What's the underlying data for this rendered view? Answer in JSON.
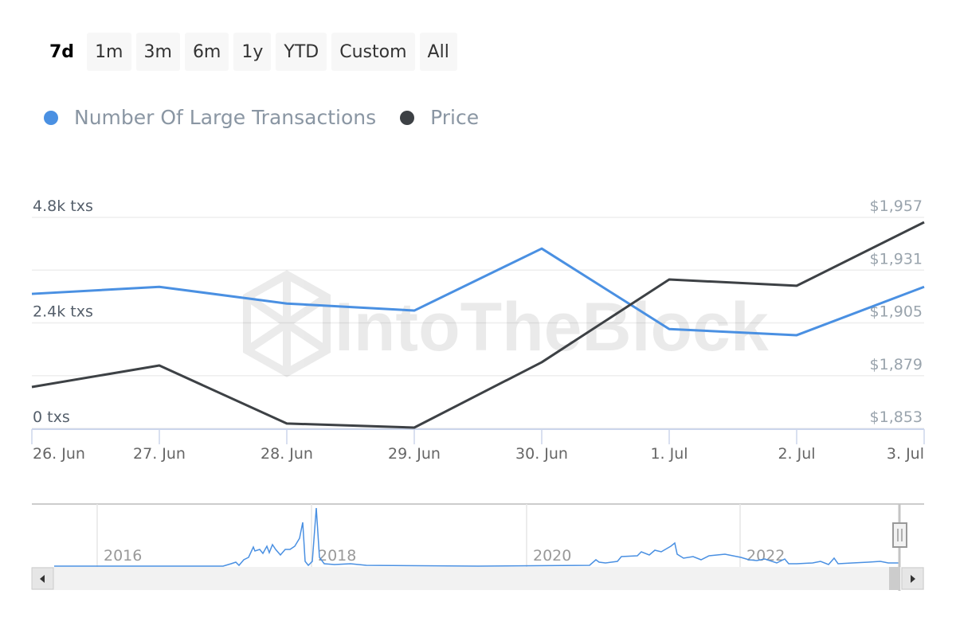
{
  "range_selector": {
    "buttons": [
      {
        "label": "7d",
        "active": true
      },
      {
        "label": "1m",
        "active": false
      },
      {
        "label": "3m",
        "active": false
      },
      {
        "label": "6m",
        "active": false
      },
      {
        "label": "1y",
        "active": false
      },
      {
        "label": "YTD",
        "active": false
      },
      {
        "label": "Custom",
        "active": false
      },
      {
        "label": "All",
        "active": false
      }
    ]
  },
  "watermark": "IntoTheBlock",
  "colors": {
    "transactions": "#4a90e2",
    "price": "#3d4145",
    "grid": "#eeeeee",
    "axis_line": "#ccd6eb",
    "left_axis_text": "#555f6b",
    "right_axis_text": "#9aa4ad",
    "x_axis_text": "#666666"
  },
  "chart_data": {
    "type": "line",
    "title": "",
    "categories": [
      "26. Jun",
      "27. Jun",
      "28. Jun",
      "29. Jun",
      "30. Jun",
      "1. Jul",
      "2. Jul",
      "3. Jul"
    ],
    "series": [
      {
        "name": "Number Of Large Transactions",
        "axis": "left",
        "values": [
          3060,
          3220,
          2840,
          2680,
          4090,
          2260,
          2120,
          3220
        ]
      },
      {
        "name": "Price",
        "axis": "right",
        "values": [
          1873.4,
          1884.0,
          1855.4,
          1853.4,
          1885.6,
          1926.4,
          1923.3,
          1954.6
        ]
      }
    ],
    "y_left": {
      "ticks": [
        "0 txs",
        "2.4k txs",
        "4.8k txs"
      ],
      "tick_values": [
        0,
        2400,
        4800
      ],
      "ylim": [
        0,
        4800
      ]
    },
    "y_right": {
      "ticks": [
        "$1,853",
        "$1,879",
        "$1,905",
        "$1,931",
        "$1,957"
      ],
      "tick_values": [
        1853,
        1879,
        1905,
        1931,
        1957
      ],
      "ylim": [
        1853,
        1957
      ]
    },
    "legend": [
      "Number Of Large Transactions",
      "Price"
    ],
    "legend_position": "top-left",
    "grid": true,
    "navigator": {
      "year_labels": [
        "2016",
        "2018",
        "2020",
        "2022"
      ],
      "series_name": "Number Of Large Transactions (full history)"
    }
  }
}
